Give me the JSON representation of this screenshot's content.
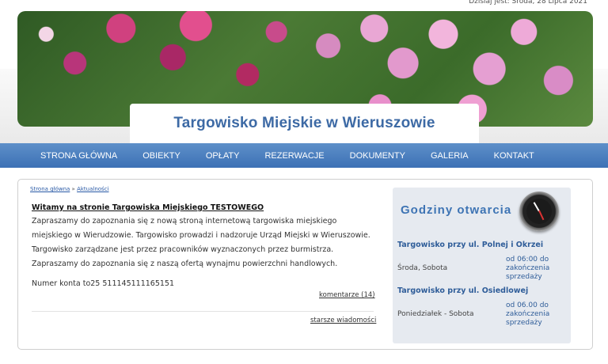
{
  "header": {
    "date_label": "Dzisiaj jest: Środa, 28 Lipca 2021",
    "site_title": "Targowisko Miejskie w Wieruszowie"
  },
  "nav": {
    "items": [
      "STRONA GŁÓWNA",
      "OBIEKTY",
      "OPŁATY",
      "REZERWACJE",
      "DOKUMENTY",
      "GALERIA",
      "KONTAKT"
    ]
  },
  "breadcrumb": {
    "home": "Strona główna",
    "separator": "»",
    "current": "Aktualności"
  },
  "article": {
    "title": "Witamy na stronie Targowiska Miejskiego TESTOWEGO",
    "body": "Zapraszamy do zapoznania się z nową stroną internetową targowiska miejskiego miejskiego w Wierudzowie. Targowisko prowadzi i nadzoruje Urząd Miejski w Wieruszowie. Targowisko zarządzane jest przez pracowników wyznaczonych przez burmistrza. Zapraszamy do zapoznania się z naszą ofertą wynajmu powierzchni handlowych.",
    "account": "Numer konta to25 511145111165151",
    "comments_link": "komentarze (14)"
  },
  "older_news": "starsze wiadomości",
  "opening_hours": {
    "title": "Godziny otwarcia",
    "entries": [
      {
        "location": "Targowisko przy ul. Polnej i Okrzei",
        "days": "Środa, Sobota",
        "hours": "od 06:00 do zakończenia sprzedaży"
      },
      {
        "location": "Targowisko przy ul. Osiedlowej",
        "days": "Poniedziałek - Sobota",
        "hours": "od 06.00 do zakończenia sprzedaży"
      }
    ]
  }
}
